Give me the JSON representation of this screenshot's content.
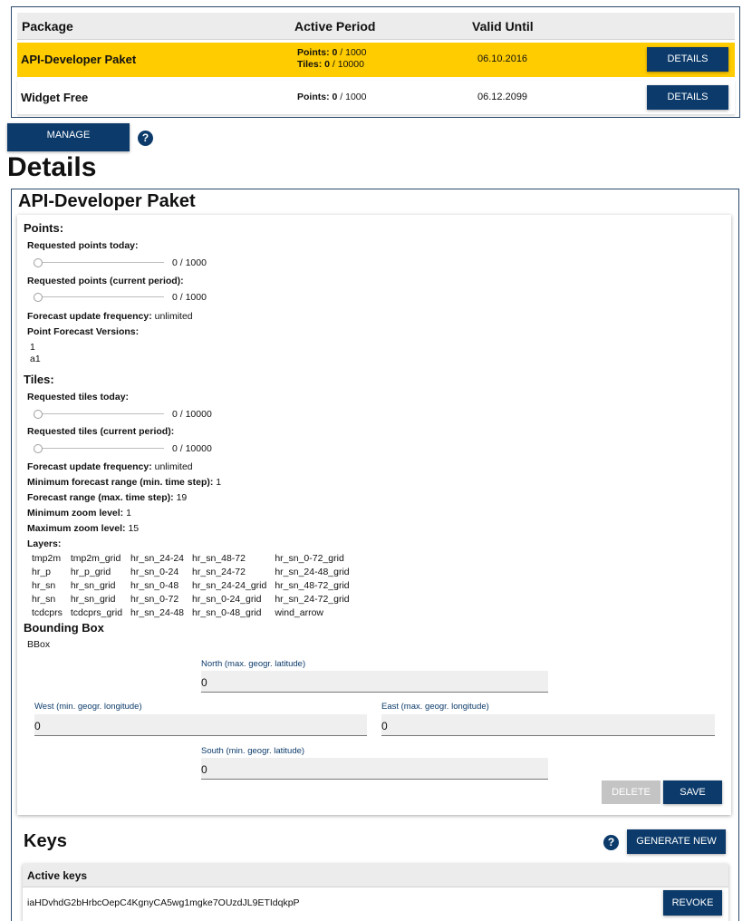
{
  "packages": {
    "headers": {
      "package": "Package",
      "active_period": "Active Period",
      "valid_until": "Valid Until"
    },
    "rows": [
      {
        "name": "API-Developer Paket",
        "points_label": "Points:",
        "points_used": "0",
        "points_total": "/ 1000",
        "tiles_label": "Tiles:",
        "tiles_used": "0",
        "tiles_total": "/ 10000",
        "valid_until": "06.10.2016",
        "button": "DETAILS",
        "highlight_color": "#ffcc00"
      },
      {
        "name": "Widget Free",
        "points_label": "Points:",
        "points_used": "0",
        "points_total": "/ 1000",
        "valid_until": "06.12.2099",
        "button": "DETAILS"
      }
    ]
  },
  "manage_button": "MANAGE SUBSCRIPTIONS",
  "help_icon": "?",
  "details_title": "Details",
  "detail": {
    "package_title": "API-Developer Paket",
    "points": {
      "title": "Points:",
      "today_label": "Requested points today:",
      "today_value": "0 / 1000",
      "today_fraction": 0,
      "period_label": "Requested points (current period):",
      "period_value": "0 / 1000",
      "period_fraction": 0,
      "freq_label": "Forecast update frequency:",
      "freq_value": "unlimited",
      "versions_label": "Point Forecast Versions:",
      "versions": [
        "1",
        "a1"
      ]
    },
    "tiles": {
      "title": "Tiles:",
      "today_label": "Requested tiles today:",
      "today_value": "0 / 10000",
      "today_fraction": 0,
      "period_label": "Requested tiles (current period):",
      "period_value": "0 / 10000",
      "period_fraction": 0,
      "freq_label": "Forecast update frequency:",
      "freq_value": "unlimited",
      "min_range_label": "Minimum forecast range (min. time step):",
      "min_range_value": "1",
      "range_label": "Forecast range (max. time step):",
      "range_value": "19",
      "min_zoom_label": "Minimum zoom level:",
      "min_zoom_value": "1",
      "max_zoom_label": "Maximum zoom level:",
      "max_zoom_value": "15",
      "layers_label": "Layers:",
      "layers": [
        [
          "tmp2m",
          "tmp2m_grid",
          "hr_sn_24-24",
          "hr_sn_48-72",
          "hr_sn_0-72_grid"
        ],
        [
          "hr_p",
          "hr_p_grid",
          "hr_sn_0-24",
          "hr_sn_24-72",
          "hr_sn_24-48_grid"
        ],
        [
          "hr_sn",
          "hr_sn_grid",
          "hr_sn_0-48",
          "hr_sn_24-24_grid",
          "hr_sn_48-72_grid"
        ],
        [
          "hr_sn",
          "hr_sn_grid",
          "hr_sn_0-72",
          "hr_sn_0-24_grid",
          "hr_sn_24-72_grid"
        ],
        [
          "tcdcprs",
          "tcdcprs_grid",
          "hr_sn_24-48",
          "hr_sn_0-48_grid",
          "wind_arrow"
        ]
      ]
    },
    "bbox": {
      "title": "Bounding Box",
      "sub": "BBox",
      "north_label": "North (max. geogr. latitude)",
      "north_value": "0",
      "west_label": "West (min. geogr. longitude)",
      "west_value": "0",
      "east_label": "East (max. geogr. longitude)",
      "east_value": "0",
      "south_label": "South (min. geogr. latitude)",
      "south_value": "0"
    },
    "delete_button": "DELETE",
    "save_button": "SAVE"
  },
  "keys": {
    "title": "Keys",
    "generate_button": "GENERATE NEW KEY",
    "active_header": "Active keys",
    "items": [
      {
        "key": "iaHDvhdG2bHrbcOepC4KgnyCA5wg1mgke7OUzdJL9ETIdqkpP",
        "button": "REVOKE"
      }
    ]
  },
  "colors": {
    "primary": "#0c3b6b",
    "highlight": "#ffcc00",
    "disabled": "#c4c4c4"
  }
}
